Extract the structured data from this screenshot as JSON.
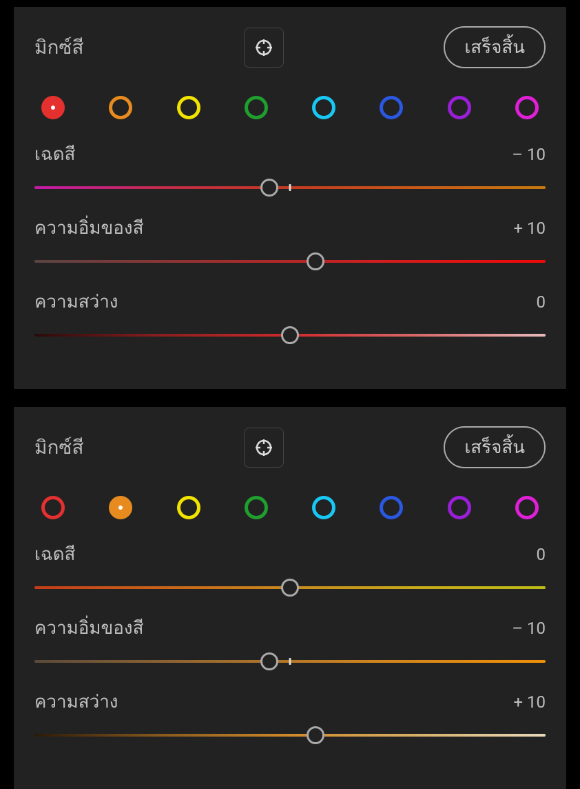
{
  "panels": [
    {
      "title": "มิกซ์สี",
      "done_label": "เสร็จสิ้น",
      "selected_swatch": 0,
      "swatches": [
        {
          "name": "red",
          "color": "#e53030"
        },
        {
          "name": "orange",
          "color": "#e88b1f"
        },
        {
          "name": "yellow",
          "color": "#f2e400"
        },
        {
          "name": "green",
          "color": "#1f9f2d"
        },
        {
          "name": "aqua",
          "color": "#18c7f3"
        },
        {
          "name": "blue",
          "color": "#2a58e0"
        },
        {
          "name": "purple",
          "color": "#9a1fd8"
        },
        {
          "name": "magenta",
          "color": "#e020d8"
        }
      ],
      "sliders": [
        {
          "label": "เฉดสี",
          "value_text": "– 10",
          "thumb_pct": 46,
          "center_tick_pct": 50,
          "gradient": "linear-gradient(to right,#c31aa8,#c22b4a,#c33a20,#c85a18,#c77a10)"
        },
        {
          "label": "ความอิ่มของสี",
          "value_text": "+ 10",
          "thumb_pct": 55,
          "gradient": "linear-gradient(to right,#5a4444,#9a3030,#d01f1f,#f00808)"
        },
        {
          "label": "ความสว่าง",
          "value_text": "0",
          "thumb_pct": 50,
          "gradient": "linear-gradient(to right,#2a0a0a,#8a1f1f,#cf2a2a,#d86a6a,#e8baba)"
        }
      ]
    },
    {
      "title": "มิกซ์สี",
      "done_label": "เสร็จสิ้น",
      "selected_swatch": 1,
      "swatches": [
        {
          "name": "red",
          "color": "#e53030"
        },
        {
          "name": "orange",
          "color": "#e88b1f"
        },
        {
          "name": "yellow",
          "color": "#f2e400"
        },
        {
          "name": "green",
          "color": "#1f9f2d"
        },
        {
          "name": "aqua",
          "color": "#18c7f3"
        },
        {
          "name": "blue",
          "color": "#2a58e0"
        },
        {
          "name": "purple",
          "color": "#9a1fd8"
        },
        {
          "name": "magenta",
          "color": "#e020d8"
        }
      ],
      "sliders": [
        {
          "label": "เฉดสี",
          "value_text": "0",
          "thumb_pct": 50,
          "gradient": "linear-gradient(to right,#c43c18,#c8641a,#c88a1c,#c8ab1a,#bcbc18)"
        },
        {
          "label": "ความอิ่มของสี",
          "value_text": "– 10",
          "thumb_pct": 46,
          "center_tick_pct": 50,
          "gradient": "linear-gradient(to right,#5a4a3a,#9a6a30,#d0851f,#f09008)"
        },
        {
          "label": "ความสว่าง",
          "value_text": "+ 10",
          "thumb_pct": 55,
          "gradient": "linear-gradient(to right,#2a1a08,#8a5a1f,#cf8a2a,#d8b06a,#e8d8ba)"
        }
      ]
    }
  ]
}
